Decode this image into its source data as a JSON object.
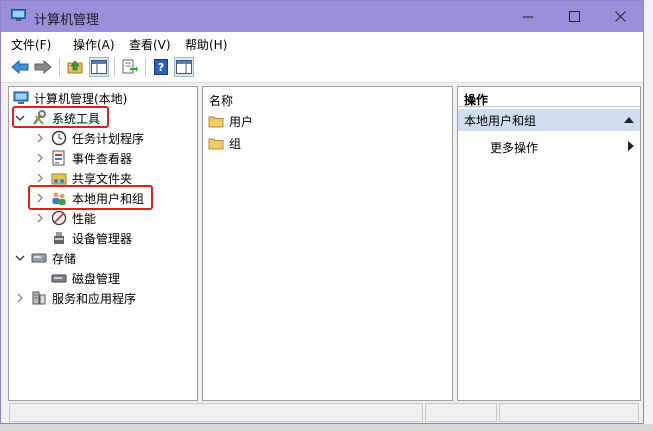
{
  "window": {
    "title": "计算机管理",
    "colors": {
      "titlebar": "#9a8fd8",
      "selection": "#cfdff0",
      "highlight": "#e02020"
    }
  },
  "menu": {
    "items": [
      "文件(F)",
      "操作(A)",
      "查看(V)",
      "帮助(H)"
    ]
  },
  "toolbar": {
    "buttons": [
      "back-arrow-icon",
      "forward-arrow-icon",
      "up-folder-icon",
      "show-hide-tree-icon",
      "export-list-icon",
      "help-icon",
      "properties-icon"
    ]
  },
  "tree": {
    "root": "计算机管理(本地)",
    "system_tools": "系统工具",
    "task_scheduler": "任务计划程序",
    "event_viewer": "事件查看器",
    "shared_folders": "共享文件夹",
    "local_users_groups": "本地用户和组",
    "performance": "性能",
    "device_manager": "设备管理器",
    "storage": "存储",
    "disk_management": "磁盘管理",
    "services_apps": "服务和应用程序"
  },
  "list": {
    "column": "名称",
    "items": [
      "用户",
      "组"
    ]
  },
  "actions": {
    "header": "操作",
    "section": "本地用户和组",
    "more": "更多操作"
  }
}
